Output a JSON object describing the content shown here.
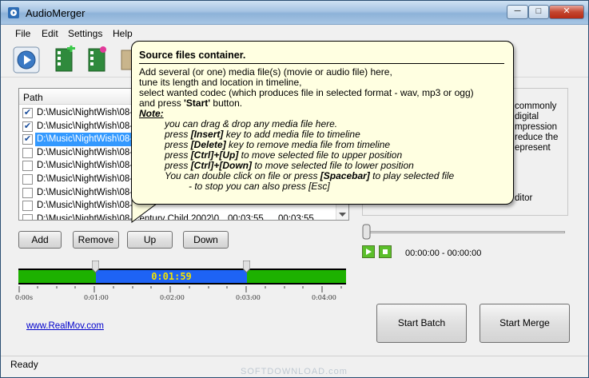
{
  "window": {
    "title": "AudioMerger"
  },
  "menu": [
    "File",
    "Edit",
    "Settings",
    "Help"
  ],
  "file_list": {
    "header_path": "Path",
    "rows": [
      {
        "checked": true,
        "path": "D:\\Music\\NightWish\\08-C",
        "start": "",
        "end": "",
        "selected": false
      },
      {
        "checked": true,
        "path": "D:\\Music\\NightWish\\08-C",
        "start": "",
        "end": "",
        "selected": false
      },
      {
        "checked": true,
        "path": "D:\\Music\\NightWish\\08-C",
        "start": "",
        "end": "",
        "selected": true
      },
      {
        "checked": false,
        "path": "D:\\Music\\NightWish\\08-C",
        "start": "",
        "end": "",
        "selected": false
      },
      {
        "checked": false,
        "path": "D:\\Music\\NightWish\\08-C",
        "start": "",
        "end": "",
        "selected": false
      },
      {
        "checked": false,
        "path": "D:\\Music\\NightWish\\08-C",
        "start": "",
        "end": "",
        "selected": false
      },
      {
        "checked": false,
        "path": "D:\\Music\\NightWish\\08-C",
        "start": "",
        "end": "",
        "selected": false
      },
      {
        "checked": false,
        "path": "D:\\Music\\NightWish\\08-C",
        "start": "",
        "end": "",
        "selected": false
      },
      {
        "checked": false,
        "path": "D:\\Music\\NightWish\\08-Century Child 2002\\0...",
        "start": "00:03:55",
        "end": "00:03:55",
        "selected": false
      }
    ]
  },
  "list_buttons": {
    "add": "Add",
    "remove": "Remove",
    "up": "Up",
    "down": "Down"
  },
  "timeline": {
    "current_time": "0:01:59",
    "ticks": [
      "0:00s",
      "0:01:00",
      "0:02:00",
      "0:03:00",
      "0:04:00"
    ]
  },
  "link_text": "www.RealMov.com",
  "right_panel": {
    "desc_lines": [
      "commonly",
      "digital",
      "mpression",
      "reduce the",
      "epresent"
    ],
    "editor_label": "ditor"
  },
  "player": {
    "time_display": "00:00:00 - 00:00:00"
  },
  "actions": {
    "batch": "Start Batch",
    "merge": "Start Merge"
  },
  "status": "Ready",
  "watermark": "SOFTDOWNLOAD.com",
  "tooltip": {
    "title": "Source files container.",
    "lines": [
      "Add several (or one) media file(s) (movie or audio file) here,",
      "tune its length and location in timeline,",
      "select wanted codec (which produces file in selected format - wav, mp3 or ogg)"
    ],
    "start_line_pre": "and press ",
    "start_line_bold": "'Start'",
    "start_line_post": " button.",
    "note_label": "Note:",
    "notes": [
      {
        "pre": "you can drag & drop any media file here.",
        "bold": "",
        "post": ""
      },
      {
        "pre": "press ",
        "bold": "[Insert]",
        "post": " key to add media file to timeline"
      },
      {
        "pre": "press ",
        "bold": "[Delete]",
        "post": " key to remove media file from timeline"
      },
      {
        "pre": "press ",
        "bold": "[Ctrl]+[Up]",
        "post": " to move selected file to upper position"
      },
      {
        "pre": "press ",
        "bold": "[Ctrl]+[Down]",
        "post": " to move selected file to lower position"
      },
      {
        "pre": "You can double click on file or press ",
        "bold": "[Spacebar]",
        "post": " to play selected file"
      }
    ],
    "last_note": "- to stop you can also press [Esc]"
  },
  "colors": {
    "timeline_green": "#1db100",
    "timeline_selection": "#1e63f5",
    "timeline_time": "#f4e400",
    "selected_row": "#3399ff",
    "tooltip_bg": "#ffffe1"
  }
}
